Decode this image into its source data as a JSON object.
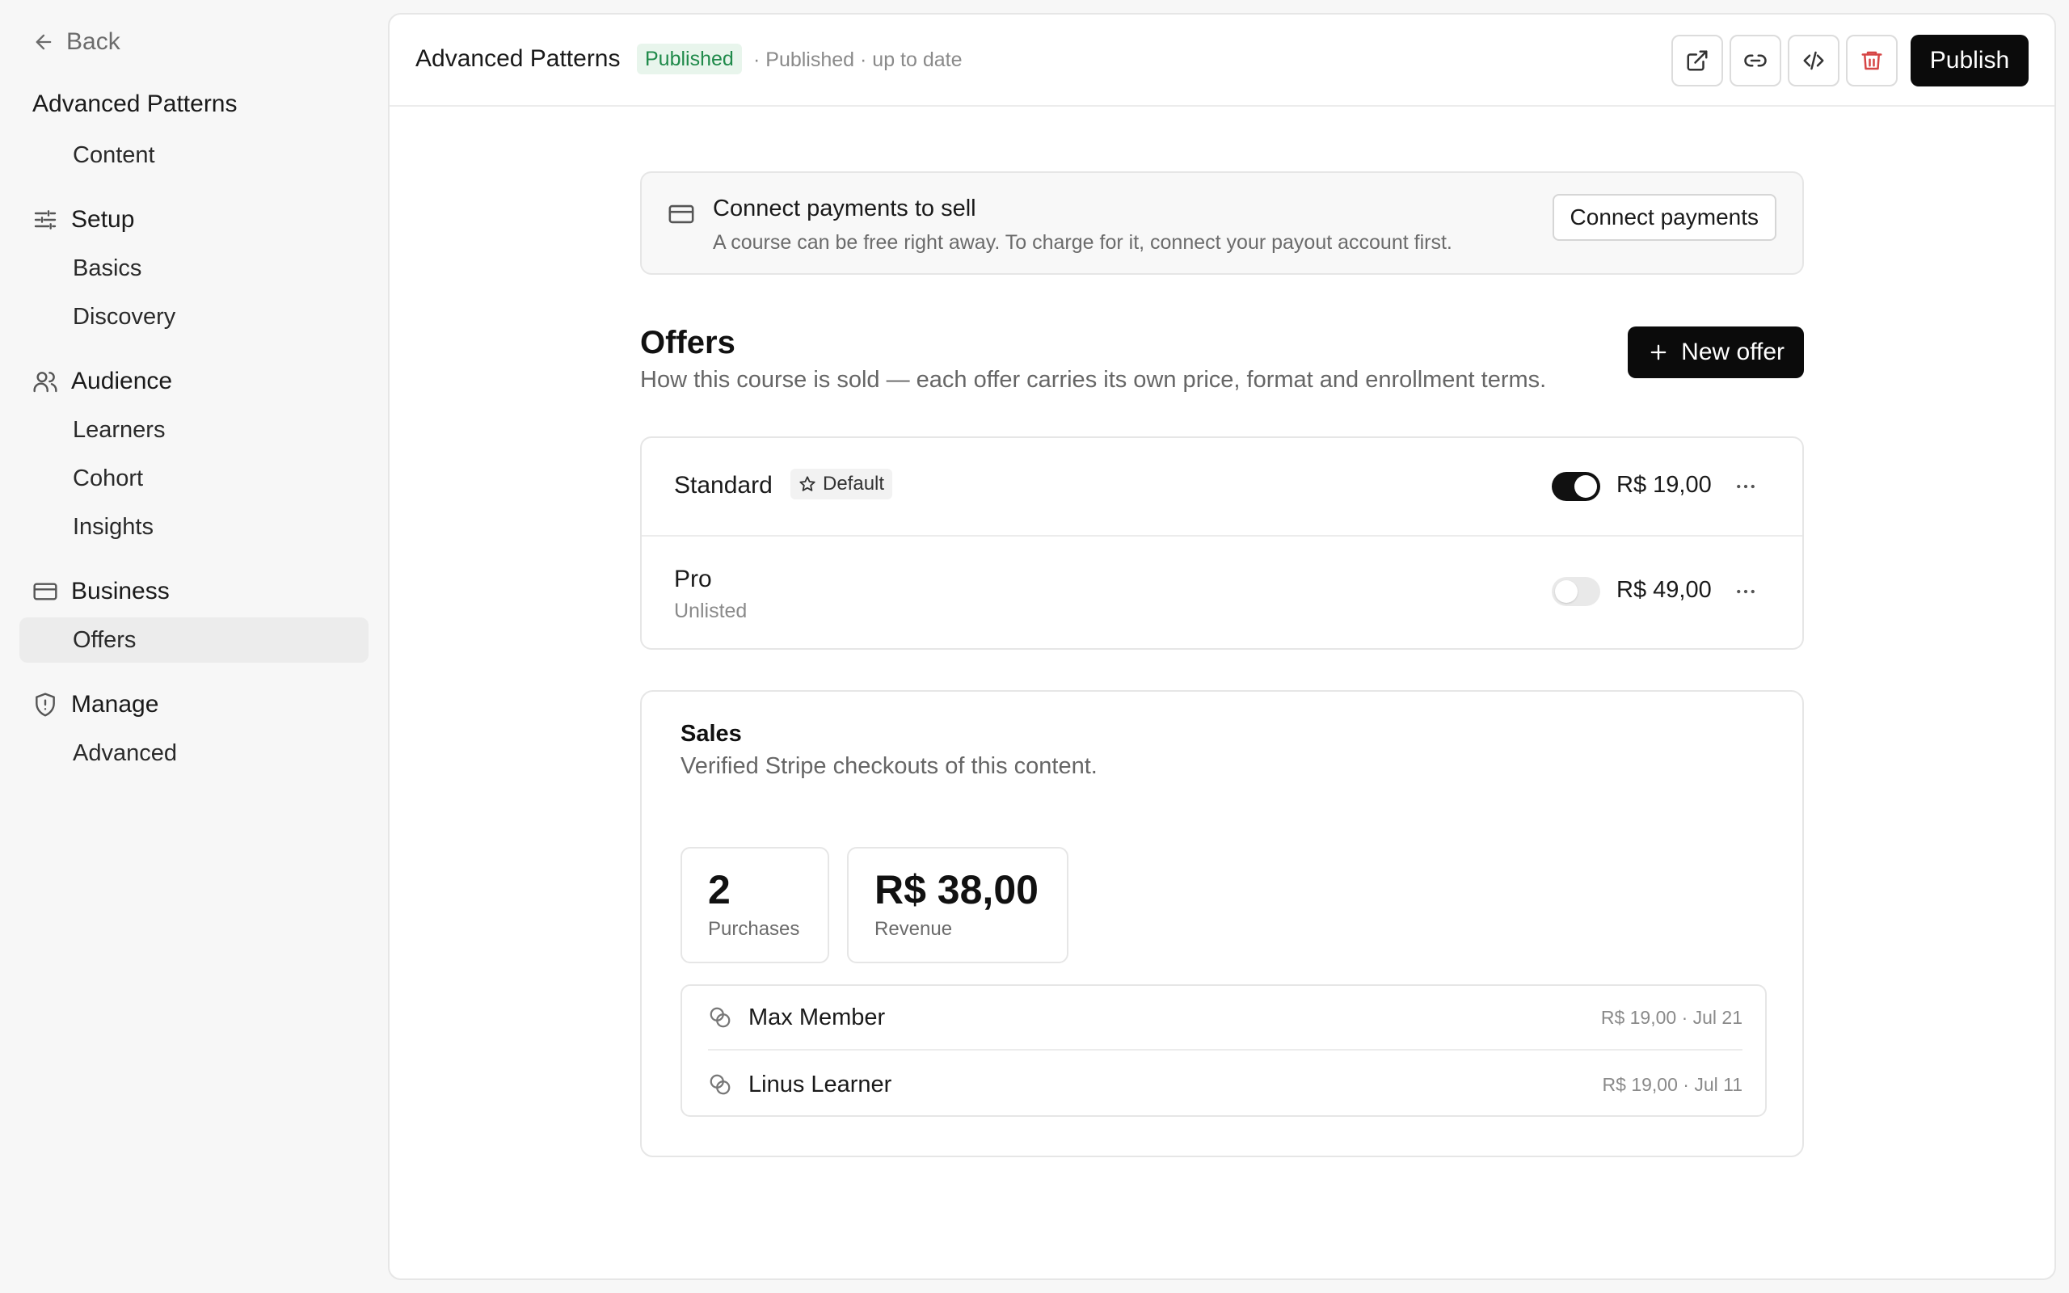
{
  "sidebar": {
    "back_label": "Back",
    "course_title": "Advanced Patterns",
    "content_item": "Content",
    "groups": {
      "setup": {
        "label": "Setup",
        "items": [
          "Basics",
          "Discovery"
        ]
      },
      "audience": {
        "label": "Audience",
        "items": [
          "Learners",
          "Cohort",
          "Insights"
        ]
      },
      "business": {
        "label": "Business",
        "items": [
          "Offers"
        ]
      },
      "manage": {
        "label": "Manage",
        "items": [
          "Advanced"
        ]
      }
    },
    "active_item": "Offers"
  },
  "header": {
    "title": "Advanced Patterns",
    "status_badge": "Published",
    "status_text": "· Published · up to date",
    "icons": [
      "external-link-icon",
      "link-icon",
      "code-icon",
      "trash-icon"
    ],
    "publish_label": "Publish"
  },
  "connect": {
    "title": "Connect payments to sell",
    "subtitle": "A course can be free right away. To charge for it, connect your payout account first.",
    "button_label": "Connect payments"
  },
  "offers": {
    "title": "Offers",
    "subtitle": "How this course is sold —  each offer carries its own price, format and enrollment terms.",
    "new_offer_label": "New offer",
    "items": [
      {
        "name": "Standard",
        "badge": "Default",
        "meta": "",
        "price": "R$ 19,00",
        "enabled": true
      },
      {
        "name": "Pro",
        "badge": "",
        "meta": "Unlisted",
        "price": "R$ 49,00",
        "enabled": false
      }
    ]
  },
  "sales": {
    "title": "Sales",
    "subtitle": "Verified Stripe checkouts of this content.",
    "stats": [
      {
        "value": "2",
        "label": "Purchases"
      },
      {
        "value": "R$ 38,00",
        "label": "Revenue"
      }
    ],
    "purchases": [
      {
        "name": "Max Member",
        "info": "R$ 19,00 · Jul 21"
      },
      {
        "name": "Linus Learner",
        "info": "R$ 19,00 · Jul 11"
      }
    ]
  },
  "colors": {
    "primary_button": "#0b0b0b",
    "published_badge_bg": "#e8f5ec",
    "published_badge_text": "#1f8a4a",
    "danger_icon": "#d64545",
    "active_nav_bg": "#ececec"
  }
}
